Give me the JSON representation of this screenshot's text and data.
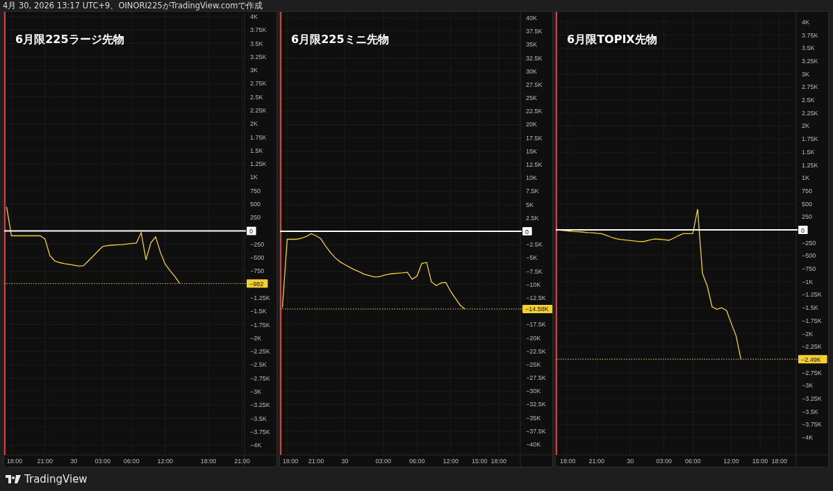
{
  "header": {
    "text": "4月 30, 2026 13:17 UTC+9、OINORI225がTradingView.comで作成"
  },
  "panels": [
    {
      "title": "6月限225ラージ先物",
      "chart_data": {
        "type": "line",
        "ylim": [
          -4180,
          4090
        ],
        "categories": [
          null,
          "18:00",
          null,
          null,
          null,
          null,
          null,
          null,
          "21:00",
          null,
          null,
          null,
          null,
          null,
          "30",
          null,
          null,
          null,
          null,
          null,
          "03:00",
          null,
          null,
          null,
          null,
          null,
          "06:00",
          null,
          null,
          null,
          null,
          null,
          null,
          "12:00",
          null,
          null,
          null,
          null,
          null,
          null,
          null,
          null,
          "18:00",
          null,
          null,
          null,
          null,
          null,
          null,
          "21:00"
        ],
        "series": [
          {
            "color": "#f5d130",
            "values": [
              450,
              -90,
              -90,
              -90,
              -90,
              -90,
              -90,
              -90,
              -150,
              -460,
              -560,
              -590,
              -610,
              -625,
              -640,
              -655,
              -650,
              -560,
              -470,
              -380,
              -290,
              -275,
              -265,
              -260,
              -255,
              -245,
              -235,
              -225,
              -30,
              -540,
              -220,
              -110,
              -400,
              -620,
              -740,
              -850,
              -980,
              null,
              null,
              null,
              null,
              null,
              null,
              null,
              null,
              null,
              null,
              null,
              null,
              null
            ]
          }
        ],
        "yticks": [
          {
            "value": 4000,
            "label": "4K"
          },
          {
            "value": 3750,
            "label": "3.75K"
          },
          {
            "value": 3500,
            "label": "3.5K"
          },
          {
            "value": 3250,
            "label": "3.25K"
          },
          {
            "value": 3000,
            "label": "3K"
          },
          {
            "value": 2750,
            "label": "2.75K"
          },
          {
            "value": 2500,
            "label": "2.5K"
          },
          {
            "value": 2250,
            "label": "2.25K"
          },
          {
            "value": 2000,
            "label": "2K"
          },
          {
            "value": 1750,
            "label": "1.75K"
          },
          {
            "value": 1500,
            "label": "1.5K"
          },
          {
            "value": 1250,
            "label": "1.25K"
          },
          {
            "value": 1000,
            "label": "1K"
          },
          {
            "value": 750,
            "label": "750"
          },
          {
            "value": 500,
            "label": "500"
          },
          {
            "value": 250,
            "label": "250"
          },
          {
            "value": -250,
            "label": "−250"
          },
          {
            "value": -500,
            "label": "−500"
          },
          {
            "value": -750,
            "label": "−750"
          },
          {
            "value": -1250,
            "label": "−1.25K"
          },
          {
            "value": -1500,
            "label": "−1.5K"
          },
          {
            "value": -1750,
            "label": "−1.75K"
          },
          {
            "value": -2000,
            "label": "−2K"
          },
          {
            "value": -2250,
            "label": "−2.25K"
          },
          {
            "value": -2500,
            "label": "−2.5K"
          },
          {
            "value": -2750,
            "label": "−2.75K"
          },
          {
            "value": -3000,
            "label": "−3K"
          },
          {
            "value": -3250,
            "label": "−3.25K"
          },
          {
            "value": -3500,
            "label": "−3.5K"
          },
          {
            "value": -3750,
            "label": "−3.75K"
          },
          {
            "value": -4000,
            "label": "−4K"
          }
        ],
        "grid": true,
        "ref_lines": [
          {
            "axis": "y",
            "value": 0,
            "label": "0",
            "color": "#ffffff"
          },
          {
            "axis": "y",
            "value": -982,
            "label": "−982",
            "color": "#f5d130"
          }
        ]
      }
    },
    {
      "title": "6月限225ミニ先物",
      "chart_data": {
        "type": "line",
        "ylim": [
          -41950,
          41170
        ],
        "categories": [
          null,
          "18:00",
          null,
          null,
          null,
          null,
          null,
          "21:00",
          null,
          null,
          null,
          null,
          null,
          "30",
          null,
          null,
          null,
          null,
          null,
          null,
          null,
          "03:00",
          null,
          null,
          null,
          null,
          null,
          null,
          "06:00",
          null,
          null,
          null,
          null,
          null,
          null,
          "12:00",
          null,
          null,
          null,
          null,
          null,
          "15:00",
          null,
          null,
          null,
          "18:00",
          null,
          null,
          null,
          null
        ],
        "series": [
          {
            "color": "#f5d130",
            "values": [
              -14300,
              -1500,
              -1500,
              -1500,
              -1300,
              -950,
              -450,
              -850,
              -1400,
              -2800,
              -4000,
              -5000,
              -5750,
              -6250,
              -6750,
              -7200,
              -7600,
              -8050,
              -8300,
              -8550,
              -8550,
              -8300,
              -8050,
              -7950,
              -7850,
              -7800,
              -7700,
              -9000,
              -8400,
              -6050,
              -5850,
              -9500,
              -10200,
              -9700,
              -9600,
              -11300,
              -12600,
              -13900,
              -14600,
              null,
              null,
              null,
              null,
              null,
              null,
              null,
              null,
              null,
              null,
              null
            ]
          }
        ],
        "yticks": [
          {
            "value": 40000,
            "label": "40K"
          },
          {
            "value": 37500,
            "label": "37.5K"
          },
          {
            "value": 35000,
            "label": "35K"
          },
          {
            "value": 32500,
            "label": "32.5K"
          },
          {
            "value": 30000,
            "label": "30K"
          },
          {
            "value": 27500,
            "label": "27.5K"
          },
          {
            "value": 25000,
            "label": "25K"
          },
          {
            "value": 22500,
            "label": "22.5K"
          },
          {
            "value": 20000,
            "label": "20K"
          },
          {
            "value": 17500,
            "label": "17.5K"
          },
          {
            "value": 15000,
            "label": "15K"
          },
          {
            "value": 12500,
            "label": "12.5K"
          },
          {
            "value": 10000,
            "label": "10K"
          },
          {
            "value": 7500,
            "label": "7.5K"
          },
          {
            "value": 5000,
            "label": "5K"
          },
          {
            "value": 2500,
            "label": "2.5K"
          },
          {
            "value": -2500,
            "label": "−2.5K"
          },
          {
            "value": -5000,
            "label": "−5K"
          },
          {
            "value": -7500,
            "label": "−7.5K"
          },
          {
            "value": -10000,
            "label": "−10K"
          },
          {
            "value": -12500,
            "label": "−12.5K"
          },
          {
            "value": -17500,
            "label": "−17.5K"
          },
          {
            "value": -20000,
            "label": "−20K"
          },
          {
            "value": -22500,
            "label": "−22.5K"
          },
          {
            "value": -25000,
            "label": "−25K"
          },
          {
            "value": -27500,
            "label": "−27.5K"
          },
          {
            "value": -30000,
            "label": "−30K"
          },
          {
            "value": -32500,
            "label": "−32.5K"
          },
          {
            "value": -35000,
            "label": "−35K"
          },
          {
            "value": -37500,
            "label": "−37.5K"
          },
          {
            "value": -40000,
            "label": "−40K"
          }
        ],
        "grid": true,
        "ref_lines": [
          {
            "axis": "y",
            "value": 0,
            "label": "0",
            "color": "#ffffff"
          },
          {
            "axis": "y",
            "value": -14580,
            "label": "−14.58K",
            "color": "#f5d130"
          }
        ]
      }
    },
    {
      "title": "6月限TOPIX先物",
      "chart_data": {
        "type": "line",
        "ylim": [
          -4333,
          4200
        ],
        "categories": [
          null,
          null,
          "18:00",
          null,
          null,
          null,
          null,
          null,
          "21:00",
          null,
          null,
          null,
          null,
          null,
          null,
          "30",
          null,
          null,
          null,
          null,
          null,
          null,
          "03:00",
          null,
          null,
          null,
          null,
          null,
          "06:00",
          null,
          null,
          null,
          null,
          null,
          null,
          null,
          "12:00",
          null,
          null,
          null,
          null,
          null,
          "15:00",
          null,
          null,
          null,
          "18:00",
          null,
          null,
          null
        ],
        "series": [
          {
            "color": "#f5d130",
            "values": [
              0,
              -10,
              -20,
              -30,
              -35,
              -40,
              -50,
              -55,
              -65,
              -70,
              -105,
              -140,
              -170,
              -185,
              -195,
              -205,
              -215,
              -225,
              -220,
              -195,
              -175,
              -180,
              -190,
              -200,
              -160,
              -110,
              -70,
              -70,
              -70,
              400,
              -840,
              -1080,
              -1480,
              -1530,
              -1500,
              -1550,
              -1800,
              -2040,
              -2490,
              null,
              null,
              null,
              null,
              null,
              null,
              null,
              null,
              null,
              null,
              null
            ]
          }
        ],
        "yticks": [
          {
            "value": 4000,
            "label": "4K"
          },
          {
            "value": 3750,
            "label": "3.75K"
          },
          {
            "value": 3500,
            "label": "3.5K"
          },
          {
            "value": 3250,
            "label": "3.25K"
          },
          {
            "value": 3000,
            "label": "3K"
          },
          {
            "value": 2750,
            "label": "2.75K"
          },
          {
            "value": 2500,
            "label": "2.5K"
          },
          {
            "value": 2250,
            "label": "2.25K"
          },
          {
            "value": 2000,
            "label": "2K"
          },
          {
            "value": 1750,
            "label": "1.75K"
          },
          {
            "value": 1500,
            "label": "1.5K"
          },
          {
            "value": 1250,
            "label": "1.25K"
          },
          {
            "value": 1000,
            "label": "1K"
          },
          {
            "value": 750,
            "label": "750"
          },
          {
            "value": 500,
            "label": "500"
          },
          {
            "value": 250,
            "label": "250"
          },
          {
            "value": -250,
            "label": "−250"
          },
          {
            "value": -500,
            "label": "−500"
          },
          {
            "value": -750,
            "label": "−750"
          },
          {
            "value": -1000,
            "label": "−1K"
          },
          {
            "value": -1250,
            "label": "−1.25K"
          },
          {
            "value": -1500,
            "label": "−1.5K"
          },
          {
            "value": -1750,
            "label": "−1.75K"
          },
          {
            "value": -2000,
            "label": "−2K"
          },
          {
            "value": -2250,
            "label": "−2.25K"
          },
          {
            "value": -2750,
            "label": "−2.75K"
          },
          {
            "value": -3000,
            "label": "−3K"
          },
          {
            "value": -3250,
            "label": "−3.25K"
          },
          {
            "value": -3500,
            "label": "−3.5K"
          },
          {
            "value": -3750,
            "label": "−3.75K"
          },
          {
            "value": -4000,
            "label": "−4K"
          }
        ],
        "grid": true,
        "ref_lines": [
          {
            "axis": "y",
            "value": 0,
            "label": "0",
            "color": "#ffffff"
          },
          {
            "axis": "y",
            "value": -2490,
            "label": "−2.49K",
            "color": "#f5d130"
          }
        ]
      }
    }
  ],
  "footer": {
    "brand": "TradingView"
  }
}
